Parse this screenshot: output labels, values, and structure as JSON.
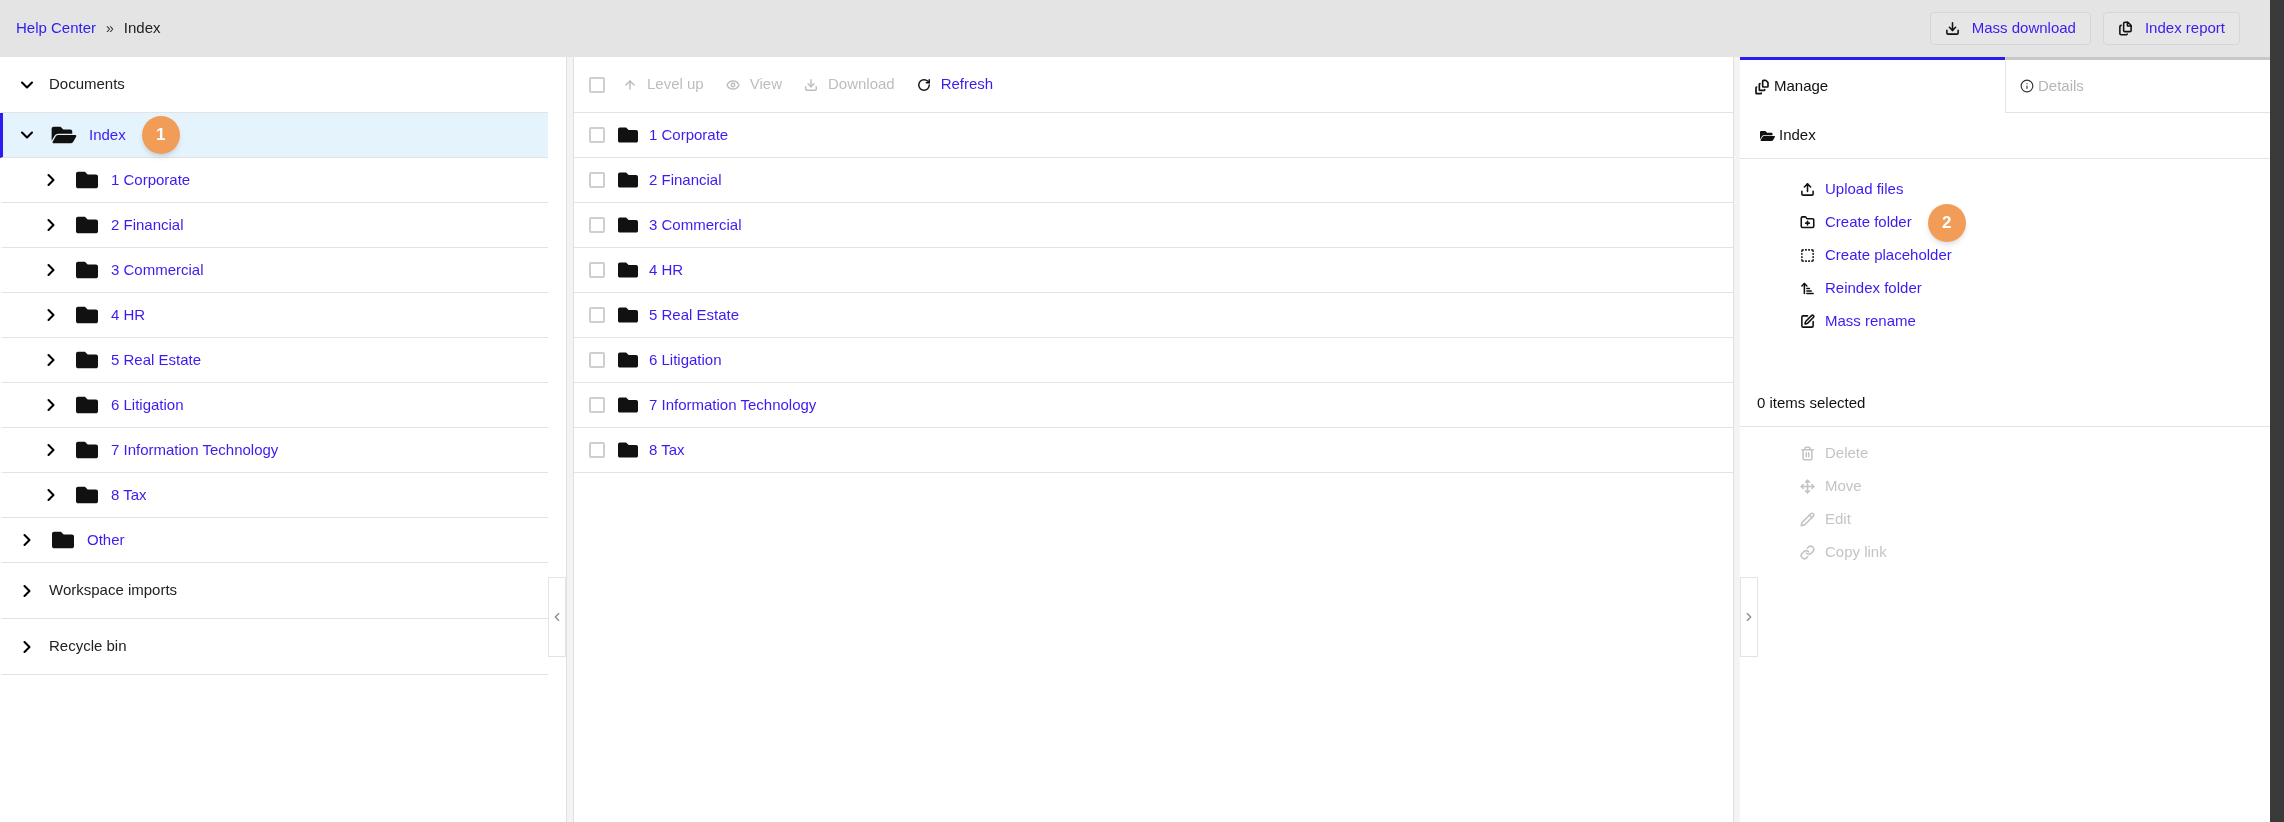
{
  "breadcrumb": {
    "items": [
      "Help Center",
      "Index"
    ],
    "separator": "»"
  },
  "header_buttons": [
    "Mass download",
    "Index report"
  ],
  "tree": [
    {
      "label": "Documents",
      "expanded": true,
      "children": [
        {
          "label": "Index",
          "expanded": true,
          "selected": true,
          "badge": "1",
          "children": [
            {
              "label": "1 Corporate",
              "expanded": false,
              "selected": false
            },
            {
              "label": "2 Financial",
              "expanded": false,
              "selected": false
            },
            {
              "label": "3 Commercial",
              "expanded": false,
              "selected": false
            },
            {
              "label": "4 HR",
              "expanded": false,
              "selected": false
            },
            {
              "label": "5 Real Estate",
              "expanded": false,
              "selected": false
            },
            {
              "label": "6 Litigation",
              "expanded": false,
              "selected": false
            },
            {
              "label": "7 Information Technology",
              "expanded": false,
              "selected": false
            },
            {
              "label": "8 Tax",
              "expanded": false,
              "selected": false
            }
          ]
        },
        {
          "label": "Other",
          "expanded": false,
          "selected": false
        }
      ]
    },
    {
      "label": "Workspace imports",
      "expanded": false
    },
    {
      "label": "Recycle bin",
      "expanded": false
    }
  ],
  "toolbar": {
    "select_all_checked": false,
    "actions": [
      {
        "label": "Level up",
        "disabled": true
      },
      {
        "label": "View",
        "disabled": true
      },
      {
        "label": "Download",
        "disabled": true
      },
      {
        "label": "Refresh",
        "disabled": false
      }
    ]
  },
  "files": [
    {
      "name": "1 Corporate",
      "checked": false
    },
    {
      "name": "2 Financial",
      "checked": false
    },
    {
      "name": "3 Commercial",
      "checked": false
    },
    {
      "name": "4 HR",
      "checked": false
    },
    {
      "name": "5 Real Estate",
      "checked": false
    },
    {
      "name": "6 Litigation",
      "checked": false
    },
    {
      "name": "7 Information Technology",
      "checked": false
    },
    {
      "name": "8 Tax",
      "checked": false
    }
  ],
  "side_panel": {
    "tabs": [
      {
        "label": "Manage",
        "selected": true
      },
      {
        "label": "Details",
        "selected": false
      }
    ],
    "folder": "Index",
    "actions": [
      {
        "label": "Upload files",
        "disabled": false
      },
      {
        "label": "Create folder",
        "disabled": false,
        "badge": "2"
      },
      {
        "label": "Create placeholder",
        "disabled": false
      },
      {
        "label": "Reindex folder",
        "disabled": false
      },
      {
        "label": "Mass rename",
        "disabled": false
      }
    ],
    "selection": "0 items selected",
    "selection_actions": [
      {
        "label": "Delete",
        "disabled": true
      },
      {
        "label": "Move",
        "disabled": true
      },
      {
        "label": "Edit",
        "disabled": true
      },
      {
        "label": "Copy link",
        "disabled": true
      }
    ]
  }
}
